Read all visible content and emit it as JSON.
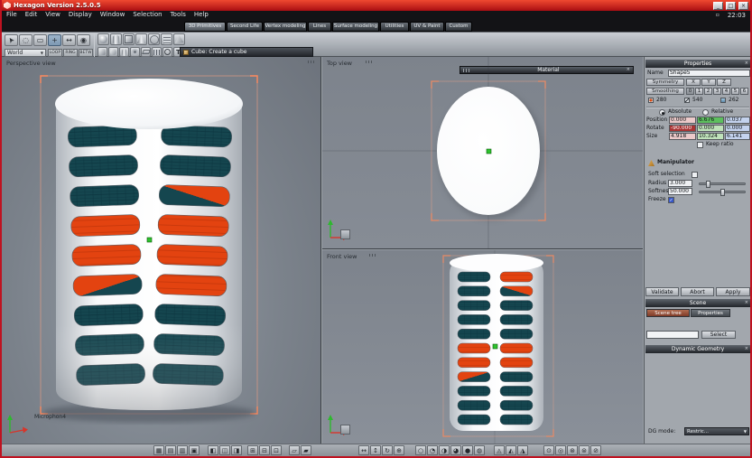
{
  "window": {
    "title": "Hexagon Version 2.5.0.5",
    "clock": "22:03"
  },
  "menu": {
    "items": [
      "File",
      "Edit",
      "View",
      "Display",
      "Window",
      "Selection",
      "Tools",
      "Help"
    ]
  },
  "tabs": {
    "items": [
      "3D Primitives",
      "Second Life",
      "Vertex modeling",
      "Lines",
      "Surface modeling",
      "Utilities",
      "UV & Paint",
      "Custom"
    ]
  },
  "toolbar": {
    "world_selector": "World",
    "selection_toggles": [
      "LOOP",
      "RING",
      "BETW"
    ],
    "status": "Cube: Create a cube"
  },
  "viewports": {
    "perspective": {
      "label": "Perspective view",
      "object_name": "Microphon4"
    },
    "top": {
      "label": "Top view",
      "material_bar": "Material"
    },
    "front": {
      "label": "Front view"
    }
  },
  "properties": {
    "header": "Properties",
    "name_label": "Name",
    "name_value": "Shape5",
    "symmetry_label": "Symmetry",
    "axis_labels": [
      "X",
      "Y",
      "Z"
    ],
    "smoothing_label": "Smoothing",
    "smoothing_levels": [
      "0",
      "1",
      "2",
      "3",
      "4",
      "5",
      "6"
    ],
    "counts": {
      "points": "280",
      "edges": "540",
      "faces": "262"
    },
    "mode_absolute": "Absolute",
    "mode_relative": "Relative",
    "position_label": "Position",
    "position": {
      "x": "0.000",
      "y": "6.676",
      "z": "0.037"
    },
    "rotate_label": "Rotate",
    "rotate": {
      "x": "-90.000",
      "y": "0.000",
      "z": "0.000"
    },
    "size_label": "Size",
    "size": {
      "x": "4.918",
      "y": "10.324",
      "z": "6.141"
    },
    "keep_ratio": "Keep ratio",
    "manipulator_header": "Manipulator",
    "soft_selection": "Soft selection",
    "radius_label": "Radius",
    "radius_value": "3.000",
    "softness_label": "Softness",
    "softness_value": "50.000",
    "freeze_label": "Freeze",
    "validate": "Validate",
    "abort": "Abort",
    "apply": "Apply"
  },
  "scene": {
    "header": "Scene",
    "tab_scene_tree": "Scene tree",
    "tab_properties": "Properties",
    "select_button": "Select"
  },
  "dynamic_geometry": {
    "header": "Dynamic Geometry",
    "dg_mode_label": "DG mode:",
    "dg_mode_value": "Restric..."
  },
  "icons": {
    "minimize": "_",
    "maximize": "□",
    "close": "×",
    "dropdown": "▼",
    "check": "✓"
  }
}
